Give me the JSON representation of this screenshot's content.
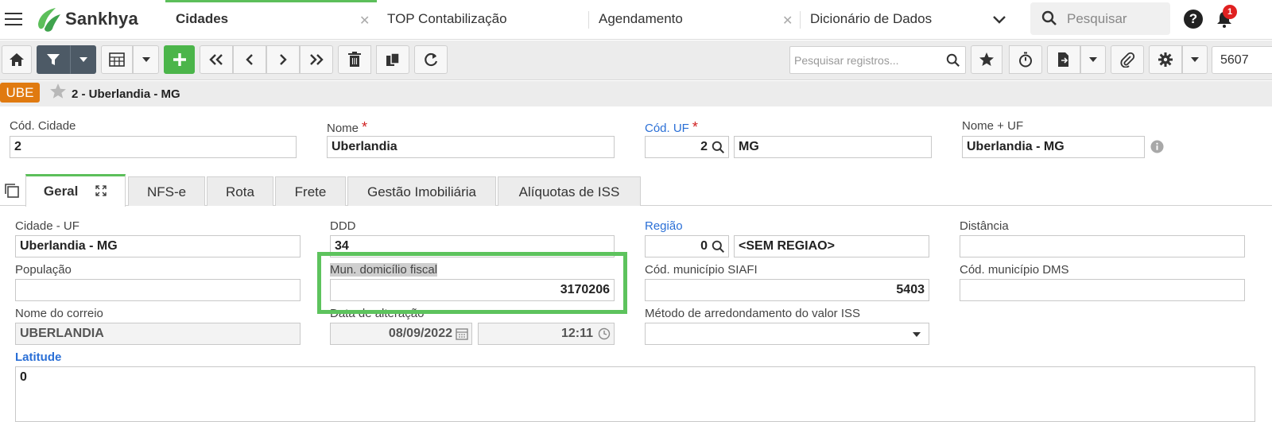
{
  "app": {
    "name": "Sankhya"
  },
  "top_tabs": [
    {
      "label": "Cidades",
      "active": true
    },
    {
      "label": "TOP Contabilização",
      "active": false
    },
    {
      "label": "Agendamento",
      "active": false
    },
    {
      "label": "Dicionário de Dados",
      "active": false
    }
  ],
  "top_search": {
    "placeholder": "Pesquisar"
  },
  "notifications": {
    "count": "1"
  },
  "toolbar": {
    "records_search_placeholder": "Pesquisar registros...",
    "page_number": "5607"
  },
  "record": {
    "badge": "UBE",
    "title": "2 - Uberlandia - MG"
  },
  "header_fields": {
    "cod_cidade": {
      "label": "Cód. Cidade",
      "value": "2"
    },
    "nome": {
      "label": "Nome",
      "value": "Uberlandia",
      "required": "*"
    },
    "cod_uf": {
      "label": "Cód. UF",
      "value": "2",
      "uf": "MG",
      "required": "*"
    },
    "nome_uf": {
      "label": "Nome + UF",
      "value": "Uberlandia - MG"
    }
  },
  "form_tabs": [
    {
      "label": "Geral",
      "active": true
    },
    {
      "label": "NFS-e"
    },
    {
      "label": "Rota"
    },
    {
      "label": "Frete"
    },
    {
      "label": "Gestão Imobiliária"
    },
    {
      "label": "Alíquotas de ISS"
    }
  ],
  "geral": {
    "cidade_uf": {
      "label": "Cidade - UF",
      "value": "Uberlandia - MG"
    },
    "ddd": {
      "label": "DDD",
      "value": "34"
    },
    "regiao": {
      "label": "Região",
      "code": "0",
      "value": "<SEM REGIAO>"
    },
    "distancia": {
      "label": "Distância",
      "value": ""
    },
    "populacao": {
      "label": "População",
      "value": ""
    },
    "mun_domicilio_fiscal": {
      "label": "Mun. domicílio fiscal",
      "value": "3170206"
    },
    "cod_siafi": {
      "label": "Cód. município SIAFI",
      "value": "5403"
    },
    "cod_dms": {
      "label": "Cód. município DMS",
      "value": ""
    },
    "nome_correio": {
      "label": "Nome do correio",
      "value": "UBERLANDIA"
    },
    "data_alteracao": {
      "label": "Data de alteração",
      "date": "08/09/2022",
      "time": "12:11"
    },
    "metodo_iss": {
      "label": "Método de arredondamento do valor ISS",
      "value": ""
    },
    "latitude": {
      "label": "Latitude",
      "value": "0"
    }
  },
  "colors": {
    "accent_green": "#5cbf5a",
    "badge_orange": "#e07a10",
    "link_blue": "#2a6fd6"
  }
}
